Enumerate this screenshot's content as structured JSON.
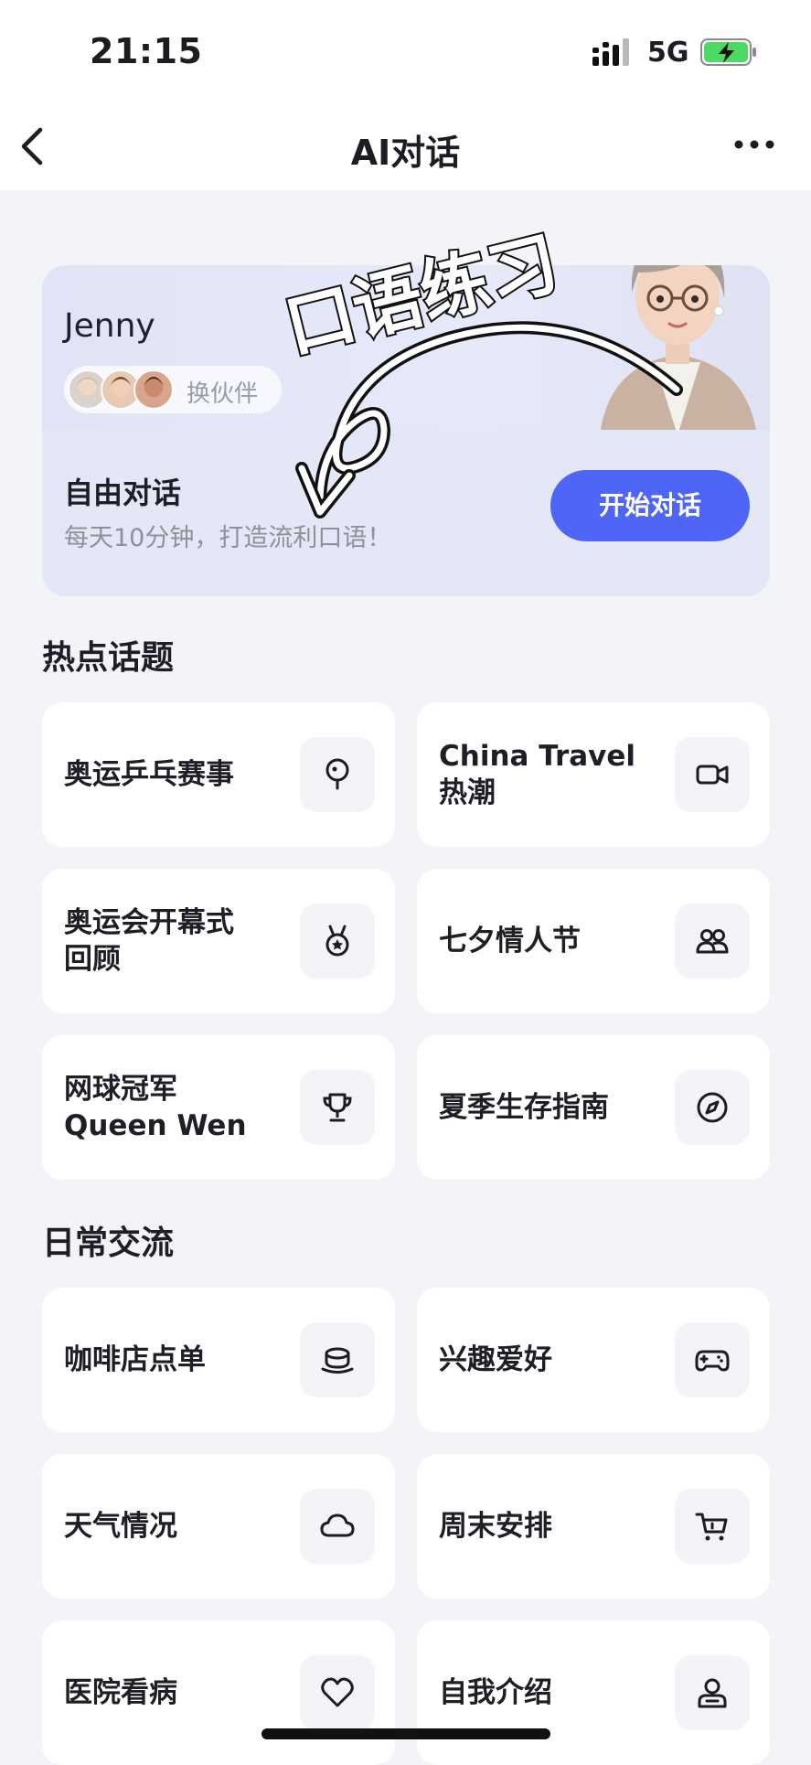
{
  "status_bar": {
    "time": "21:15",
    "network": "5G"
  },
  "nav": {
    "title": "AI对话"
  },
  "hero": {
    "partner_name": "Jenny",
    "change_partner_label": "换伙伴",
    "free_chat_title": "自由对话",
    "free_chat_subtitle": "每天10分钟，打造流利口语！",
    "start_button": "开始对话",
    "overlay_text": "口语练习"
  },
  "sections": [
    {
      "title": "热点话题",
      "cards": [
        {
          "label": "奥运乒乓赛事",
          "icon": "ping-pong-icon"
        },
        {
          "label": "China Travel\n热潮",
          "icon": "video-icon"
        },
        {
          "label": "奥运会开幕式\n回顾",
          "icon": "medal-icon"
        },
        {
          "label": "七夕情人节",
          "icon": "people-icon"
        },
        {
          "label": "网球冠军\nQueen Wen",
          "icon": "trophy-icon"
        },
        {
          "label": "夏季生存指南",
          "icon": "compass-icon"
        }
      ]
    },
    {
      "title": "日常交流",
      "cards": [
        {
          "label": "咖啡店点单",
          "icon": "coffee-cup-icon"
        },
        {
          "label": "兴趣爱好",
          "icon": "gamepad-icon"
        },
        {
          "label": "天气情况",
          "icon": "cloud-icon"
        },
        {
          "label": "周末安排",
          "icon": "cart-icon"
        },
        {
          "label": "医院看病",
          "icon": "heart-icon"
        },
        {
          "label": "自我介绍",
          "icon": "person-icon"
        }
      ]
    }
  ]
}
